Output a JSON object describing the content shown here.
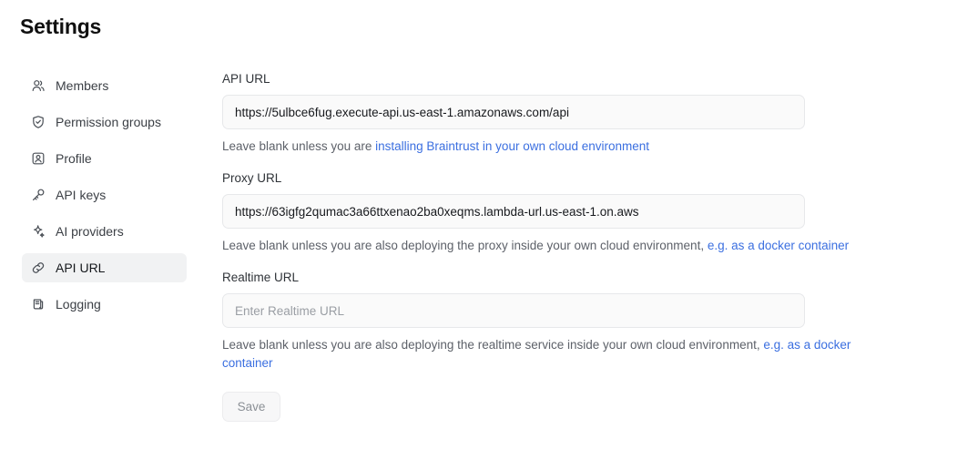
{
  "page": {
    "title": "Settings"
  },
  "sidebar": {
    "items": [
      {
        "label": "Members",
        "icon": "users-icon",
        "active": false
      },
      {
        "label": "Permission groups",
        "icon": "shield-check-icon",
        "active": false
      },
      {
        "label": "Profile",
        "icon": "id-card-icon",
        "active": false
      },
      {
        "label": "API keys",
        "icon": "key-icon",
        "active": false
      },
      {
        "label": "AI providers",
        "icon": "sparkle-icon",
        "active": false
      },
      {
        "label": "API URL",
        "icon": "link-icon",
        "active": true
      },
      {
        "label": "Logging",
        "icon": "scroll-icon",
        "active": false
      }
    ]
  },
  "form": {
    "api_url": {
      "label": "API URL",
      "value": "https://5ulbce6fug.execute-api.us-east-1.amazonaws.com/api",
      "placeholder": "Enter API URL",
      "helper_prefix": "Leave blank unless you are ",
      "helper_link": "installing Braintrust in your own cloud environment",
      "helper_suffix": ""
    },
    "proxy_url": {
      "label": "Proxy URL",
      "value": "https://63igfg2qumac3a66ttxenao2ba0xeqms.lambda-url.us-east-1.on.aws",
      "placeholder": "Enter Proxy URL",
      "helper_prefix": "Leave blank unless you are also deploying the proxy inside your own cloud environment, ",
      "helper_link": "e.g. as a docker container",
      "helper_suffix": ""
    },
    "realtime_url": {
      "label": "Realtime URL",
      "value": "",
      "placeholder": "Enter Realtime URL",
      "helper_prefix": "Leave blank unless you are also deploying the realtime service inside your own cloud environment, ",
      "helper_link": "e.g. as a docker container",
      "helper_suffix": ""
    },
    "save_label": "Save"
  },
  "colors": {
    "link": "#3b6fe0",
    "active_nav_bg": "#f1f2f3",
    "input_bg": "#fafafa",
    "input_border": "#e7e8ea",
    "helper_text": "#5d6169",
    "save_text": "#8b9096"
  }
}
